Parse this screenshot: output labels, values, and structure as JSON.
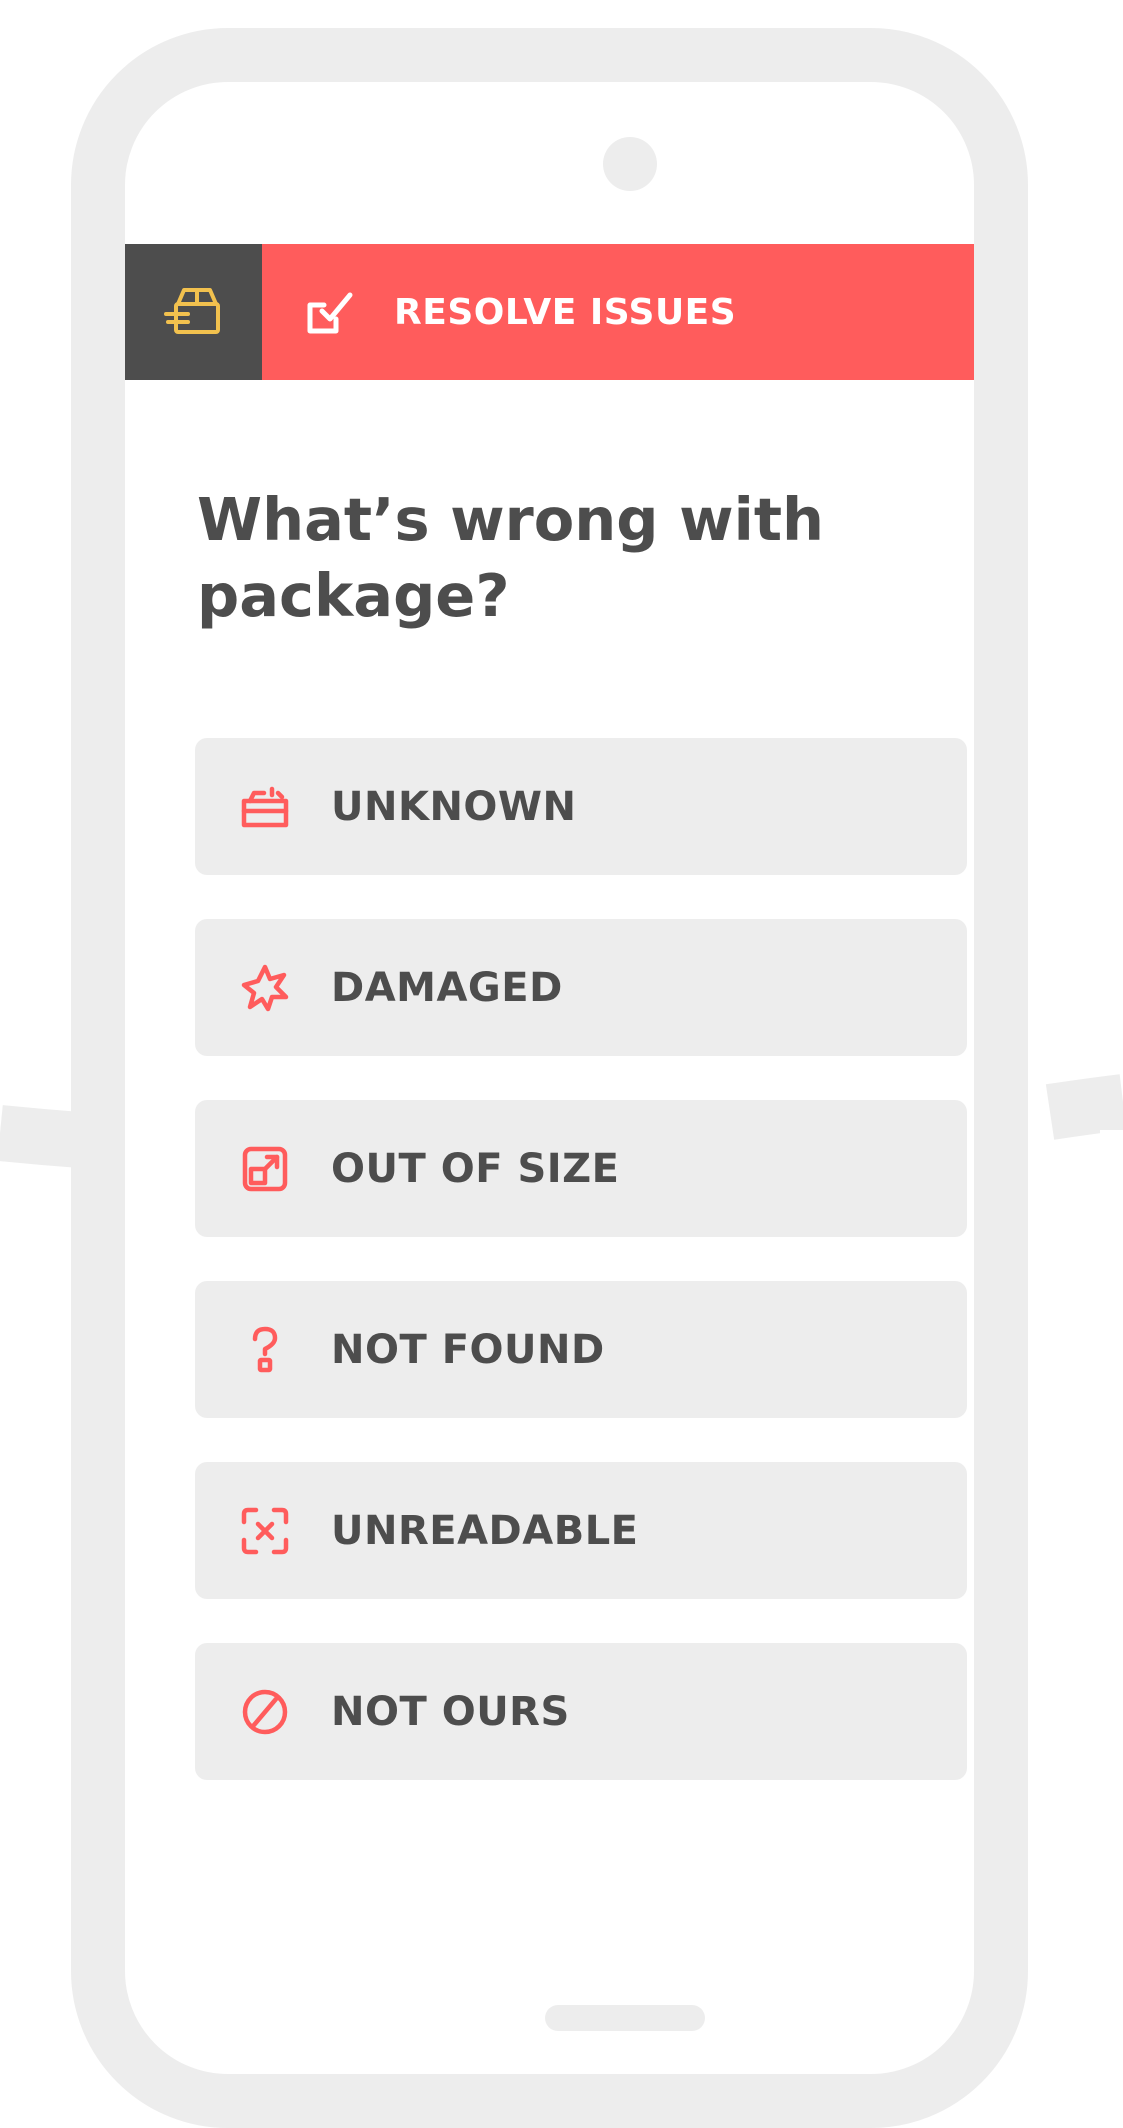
{
  "colors": {
    "accent": "#ff5c5c",
    "dark": "#4d4d4d",
    "frame": "#ededed",
    "logo": "#f2c14e"
  },
  "header": {
    "logo_icon": "package-icon",
    "section_icon": "checklist-icon",
    "title": "RESOLVE ISSUES"
  },
  "question": "What’s wrong with package?",
  "options": [
    {
      "label": "UNKNOWN",
      "icon": "open-box-icon"
    },
    {
      "label": "DAMAGED",
      "icon": "burst-icon"
    },
    {
      "label": "OUT OF SIZE",
      "icon": "resize-icon"
    },
    {
      "label": "NOT FOUND",
      "icon": "question-icon"
    },
    {
      "label": "UNREADABLE",
      "icon": "scan-error-icon"
    },
    {
      "label": "NOT OURS",
      "icon": "prohibited-icon"
    }
  ]
}
